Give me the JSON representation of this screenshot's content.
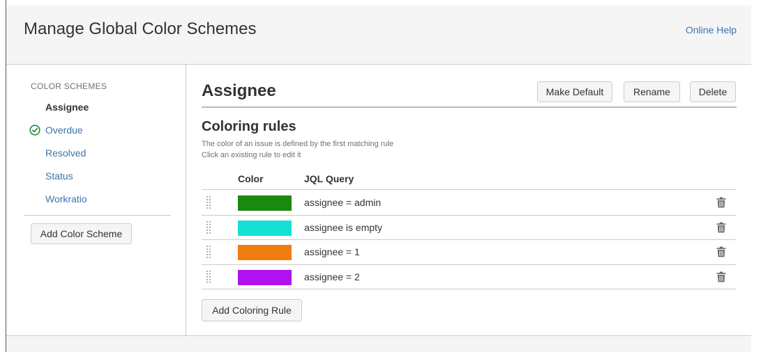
{
  "header": {
    "title": "Manage Global Color Schemes",
    "help_link": "Online Help"
  },
  "sidebar": {
    "heading": "COLOR SCHEMES",
    "schemes": [
      {
        "label": "Assignee",
        "selected": true,
        "is_default": false
      },
      {
        "label": "Overdue",
        "selected": false,
        "is_default": true,
        "icon": "check-circle-icon"
      },
      {
        "label": "Resolved",
        "selected": false,
        "is_default": false
      },
      {
        "label": "Status",
        "selected": false,
        "is_default": false
      },
      {
        "label": "Workratio",
        "selected": false,
        "is_default": false
      }
    ],
    "add_button": "Add Color Scheme"
  },
  "scheme": {
    "title": "Assignee",
    "make_default_button": "Make Default",
    "rename_button": "Rename",
    "delete_button": "Delete"
  },
  "rules": {
    "heading": "Coloring rules",
    "description_line1": "The color of an issue is defined by the first matching rule",
    "description_line2": "Click an existing rule to edit it",
    "columns": {
      "color": "Color",
      "query": "JQL Query"
    },
    "items": [
      {
        "color": "#1a8a0e",
        "query": "assignee = admin"
      },
      {
        "color": "#14e0d4",
        "query": "assignee is empty"
      },
      {
        "color": "#f07d0f",
        "query": "assignee = 1"
      },
      {
        "color": "#b012ee",
        "query": "assignee = 2"
      }
    ],
    "add_button": "Add Coloring Rule"
  },
  "colors": {
    "link": "#3b73af",
    "check_green": "#1f8a3a"
  }
}
